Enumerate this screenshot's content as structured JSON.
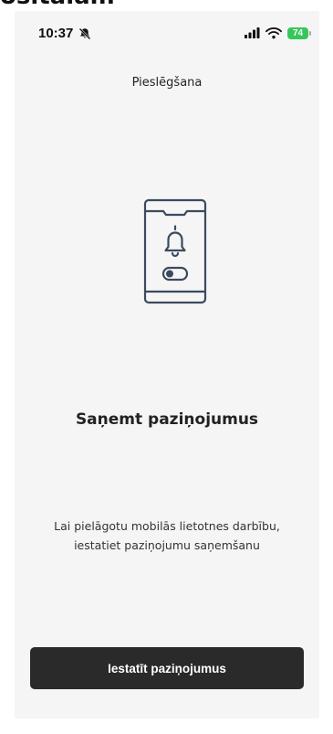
{
  "top_cut_text": "ositalam",
  "status_bar": {
    "time": "10:37",
    "battery": "74"
  },
  "screen": {
    "title": "Pieslēgšana",
    "heading": "Saņemt paziņojumus",
    "description_line1": "Lai pielāgotu mobilās lietotnes darbību,",
    "description_line2": "iestatiet paziņojumu saņemšanu",
    "button_label": "Iestatīt paziņojumus"
  },
  "icons": {
    "status_mute": "bell-slash-icon",
    "signal": "cellular-signal-icon",
    "wifi": "wifi-icon",
    "battery": "battery-icon",
    "illustration": "phone-notification-toggle-icon"
  },
  "colors": {
    "background": "#f5f5f5",
    "button": "#2a2a2a",
    "battery": "#36c759",
    "illustration_stroke": "#3b4a5e"
  }
}
